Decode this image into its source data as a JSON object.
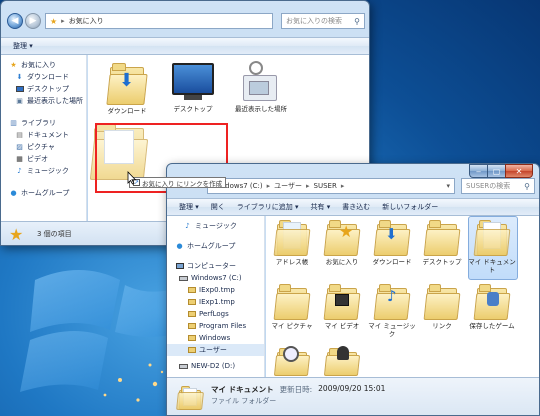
{
  "colors": {
    "accent": "#1f78c4",
    "highlight_border": "#e22222",
    "selection": "#c1dcfa"
  },
  "window_back": {
    "address": "お気に入り",
    "search_placeholder": "お気に入りの検索",
    "toolbar": {
      "organize": "整理"
    },
    "sidebar": {
      "favorites": {
        "label": "お気に入り",
        "items": [
          "ダウンロード",
          "デスクトップ",
          "最近表示した場所"
        ]
      },
      "libraries": {
        "label": "ライブラリ",
        "items": [
          "ドキュメント",
          "ピクチャ",
          "ビデオ",
          "ミュージック"
        ]
      },
      "homegroup": "ホームグループ"
    },
    "tiles": [
      "ダウンロード",
      "デスクトップ",
      "最近表示した場所"
    ],
    "status": "3 個の項目"
  },
  "drag": {
    "tooltip": "お気に入り にリンクを作成",
    "tooltip_icon": "link-arrow-icon"
  },
  "window_front": {
    "breadcrumb": [
      "Windows7 (C:)",
      "ユーザー",
      "SUSER"
    ],
    "search_placeholder": "SUSERの検索",
    "toolbar": {
      "organize": "整理",
      "open": "開く",
      "library": "ライブラリに追加",
      "share": "共有",
      "burn": "書き込む",
      "new_folder": "新しいフォルダー"
    },
    "sidebar": {
      "music": "ミュージック",
      "homegroup": "ホームグループ",
      "computer": "コンピューター",
      "drive_c": "Windows7 (C:)",
      "folders": [
        "IExp0.tmp",
        "IExp1.tmp",
        "PerfLogs",
        "Program Files",
        "Windows",
        "ユーザー"
      ],
      "drive_d": "NEW-D2 (D:)"
    },
    "tiles_row1": [
      "アドレス帳",
      "お気に入り",
      "ダウンロード",
      "デスクトップ",
      "マイ ドキュメント"
    ],
    "tiles_row2": [
      "マイ ピクチャ",
      "マイ ビデオ",
      "マイ ミュージック",
      "リンク",
      "保存したゲーム"
    ],
    "details": {
      "name": "マイ ドキュメント",
      "type": "ファイル フォルダー",
      "date_label": "更新日時:",
      "date": "2009/09/20 15:01"
    }
  }
}
